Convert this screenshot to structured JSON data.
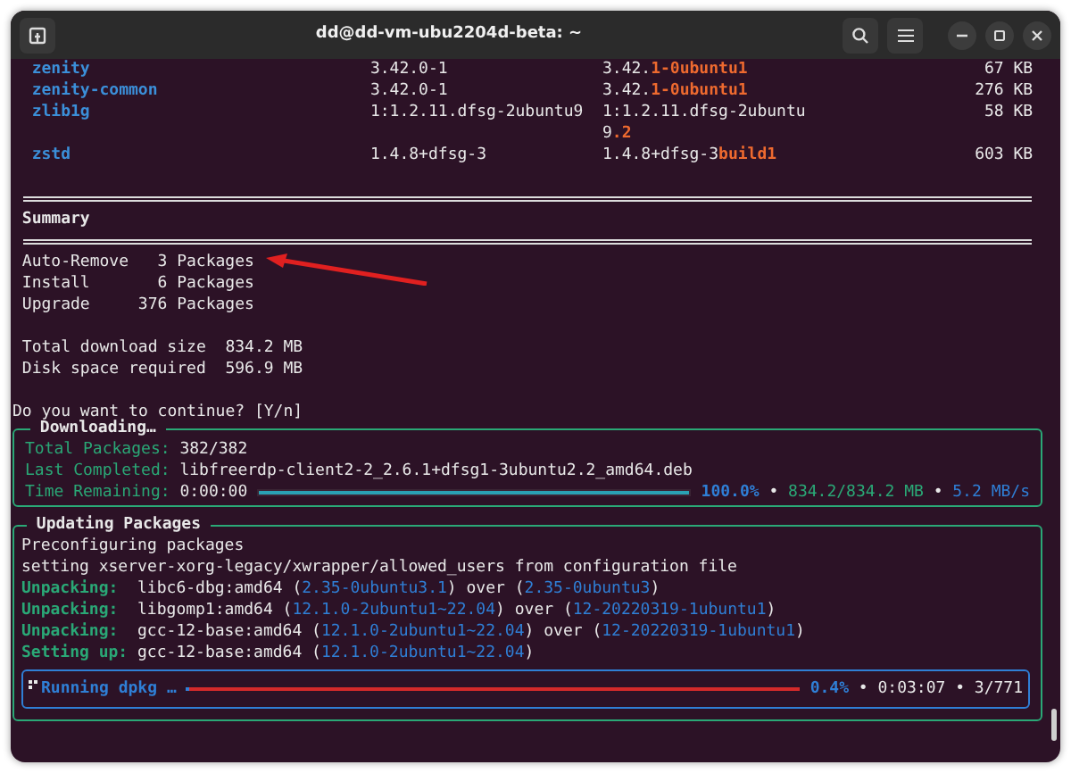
{
  "window": {
    "title": "dd@dd-vm-ubu2204d-beta: ~"
  },
  "packages": [
    {
      "name": "zenity",
      "old_version": "3.42.0-1",
      "new_version_base": "3.42.",
      "new_version_changed": "1-0ubuntu1",
      "size": "67 KB"
    },
    {
      "name": "zenity-common",
      "old_version": "3.42.0-1",
      "new_version_base": "3.42.",
      "new_version_changed": "1-0ubuntu1",
      "size": "276 KB"
    },
    {
      "name": "zlib1g",
      "old_version": "1:1.2.11.dfsg-2ubuntu9",
      "new_version_base": "1:1.2.11.dfsg-2ubuntu9",
      "new_version_changed": ".2",
      "size": "58 KB"
    },
    {
      "name": "zstd",
      "old_version": "1.4.8+dfsg-3",
      "new_version_base": "1.4.8+dfsg-3",
      "new_version_changed": "build1",
      "size": "603 KB"
    }
  ],
  "summary": {
    "title": "Summary",
    "counts": [
      {
        "label": "Auto-Remove",
        "count": "3",
        "unit": "Packages"
      },
      {
        "label": "Install",
        "count": "6",
        "unit": "Packages"
      },
      {
        "label": "Upgrade",
        "count": "376",
        "unit": "Packages"
      }
    ],
    "sizes": [
      {
        "label": "Total download size",
        "value": "834.2 MB"
      },
      {
        "label": "Disk space required",
        "value": "596.9 MB"
      }
    ]
  },
  "prompt": "Do you want to continue? [Y/n]",
  "downloading": {
    "title": "Downloading…",
    "fields": [
      {
        "label": "Total Packages:",
        "value": "382/382"
      },
      {
        "label": "Last Completed:",
        "value": "libfreerdp-client2-2_2.6.1+dfsg1-3ubuntu2.2_amd64.deb"
      },
      {
        "label": "Time Remaining:",
        "value": "0:00:00"
      }
    ],
    "level": 1,
    "percent": "100.0%",
    "separator_1": "•",
    "amount": "834.2/834.2 MB",
    "separator_2": "•",
    "speed": "5.2 MB/s"
  },
  "updating": {
    "title": "Updating Packages",
    "lines": [
      {
        "kind": "plain",
        "text": "Preconfiguring packages"
      },
      {
        "kind": "plain",
        "text": "setting xserver-xorg-legacy/xwrapper/allowed_users from configuration file"
      },
      {
        "kind": "action",
        "label": "Unpacking:",
        "segments": [
          {
            "kind": "plain",
            "text": "libc6-dbg:amd64 ("
          },
          {
            "kind": "version",
            "text": "2.35-0ubuntu3.1"
          },
          {
            "kind": "plain",
            "text": ") over ("
          },
          {
            "kind": "version",
            "text": "2.35-0ubuntu3"
          },
          {
            "kind": "plain",
            "text": ")"
          }
        ]
      },
      {
        "kind": "action",
        "label": "Unpacking:",
        "segments": [
          {
            "kind": "plain",
            "text": "libgomp1:amd64 ("
          },
          {
            "kind": "version",
            "text": "12.1.0-2ubuntu1~22.04"
          },
          {
            "kind": "plain",
            "text": ") over ("
          },
          {
            "kind": "version",
            "text": "12-20220319-1ubuntu1"
          },
          {
            "kind": "plain",
            "text": ")"
          }
        ]
      },
      {
        "kind": "action",
        "label": "Unpacking:",
        "segments": [
          {
            "kind": "plain",
            "text": "gcc-12-base:amd64 ("
          },
          {
            "kind": "version",
            "text": "12.1.0-2ubuntu1~22.04"
          },
          {
            "kind": "plain",
            "text": ") over ("
          },
          {
            "kind": "version",
            "text": "12-20220319-1ubuntu1"
          },
          {
            "kind": "plain",
            "text": ")"
          }
        ]
      },
      {
        "kind": "action",
        "label": "Setting up:",
        "segments": [
          {
            "kind": "plain",
            "text": "gcc-12-base:amd64 ("
          },
          {
            "kind": "version",
            "text": "12.1.0-2ubuntu1~22.04"
          },
          {
            "kind": "plain",
            "text": ")"
          }
        ]
      }
    ],
    "task": {
      "label": "Running dpkg …",
      "level": 0.004,
      "percent": "0.4%",
      "separator_1": "•",
      "elapsed": "0:03:07",
      "separator_2": "•",
      "count": "3/771"
    }
  }
}
